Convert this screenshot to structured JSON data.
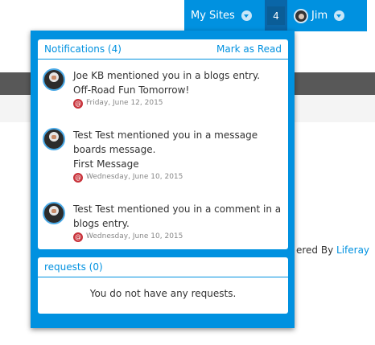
{
  "topbar": {
    "my_sites_label": "My Sites",
    "notification_count": "4",
    "user_name": "Jim"
  },
  "footer": {
    "powered_prefix": "ered By ",
    "powered_link": "Liferay"
  },
  "notifications": {
    "header_title": "Notifications (4)",
    "mark_as_read": "Mark as Read",
    "items": [
      {
        "title": "Joe KB mentioned you in a blogs entry.",
        "subtitle": "Off-Road Fun Tomorrow!",
        "date": "Friday, June 12, 2015",
        "icon": "mention-icon"
      },
      {
        "title": "Test Test mentioned you in a message boards message.",
        "subtitle": "First Message",
        "date": "Wednesday, June 10, 2015",
        "icon": "mention-icon"
      },
      {
        "title": "Test Test mentioned you in a comment in a blogs entry.",
        "subtitle": "",
        "date": "Wednesday, June 10, 2015",
        "icon": "mention-icon"
      }
    ]
  },
  "requests": {
    "header_title": "requests (0)",
    "empty_message": "You do not have any requests."
  },
  "colors": {
    "accent": "#0091e0",
    "dark_band": "#585858",
    "mention_icon": "#c8323a"
  }
}
